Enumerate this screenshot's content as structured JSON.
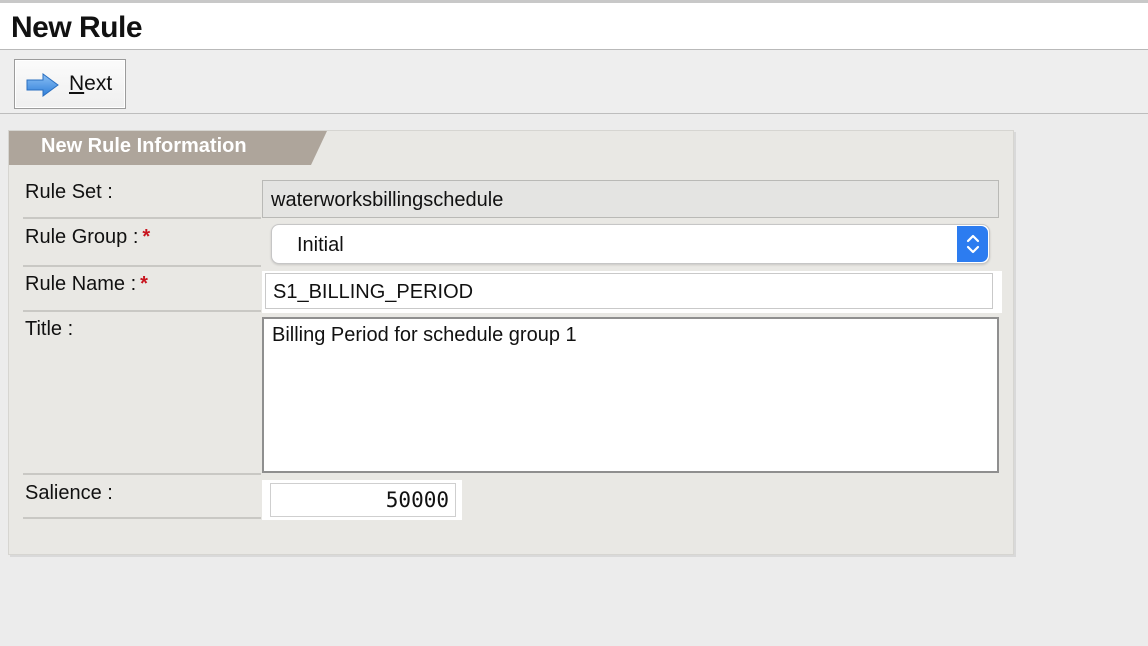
{
  "page": {
    "title": "New Rule"
  },
  "toolbar": {
    "next_label_underlined": "N",
    "next_label_rest": "ext",
    "next_icon": "arrow-right-icon"
  },
  "panel": {
    "title": "New Rule Information",
    "header_color": "#aea59b"
  },
  "form": {
    "rule_set": {
      "label": "Rule Set :",
      "value": "waterworksbillingschedule"
    },
    "rule_group": {
      "label": "Rule Group :",
      "required_mark": "*",
      "value": "Initial"
    },
    "rule_name": {
      "label": "Rule Name :",
      "required_mark": "*",
      "value": "S1_BILLING_PERIOD"
    },
    "title": {
      "label": "Title :",
      "value": "Billing Period for schedule group 1"
    },
    "salience": {
      "label": "Salience :",
      "value": "50000"
    }
  },
  "colors": {
    "required": "#c8141e",
    "select_accent": "#2c7cf0"
  }
}
